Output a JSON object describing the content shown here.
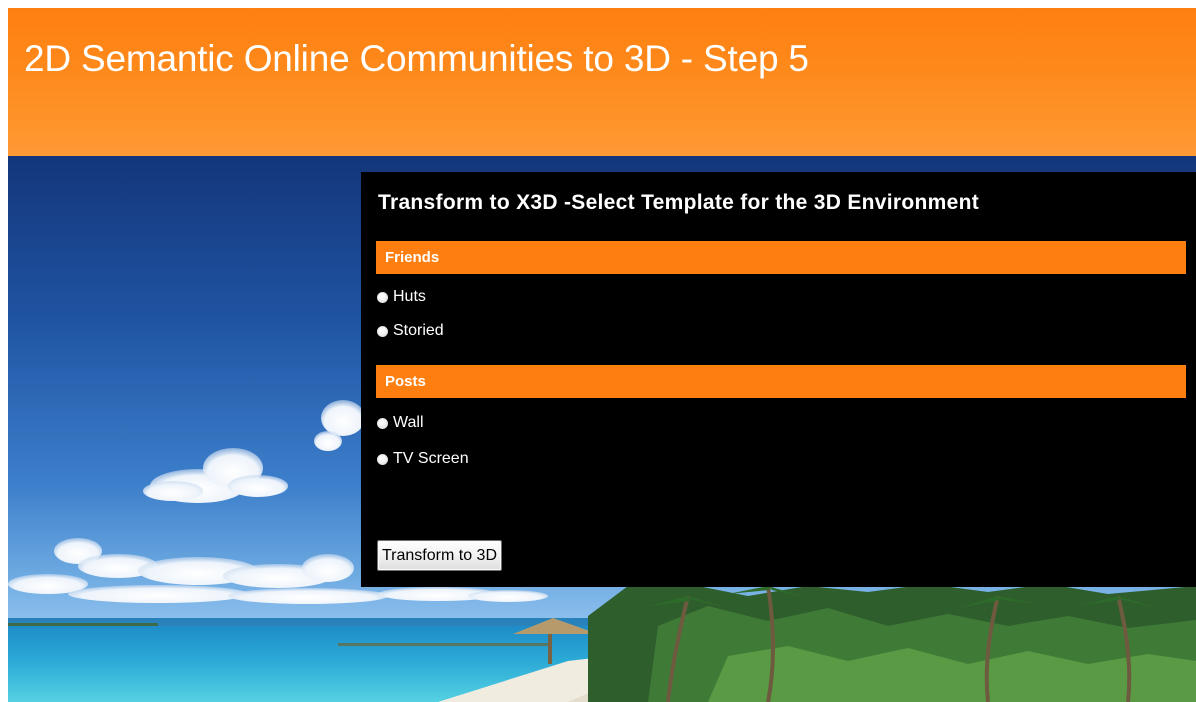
{
  "header": {
    "title": "2D Semantic Online Communities to 3D - Step 5"
  },
  "panel": {
    "title": "Transform to X3D -Select Template for the 3D Environment",
    "sections": [
      {
        "heading": "Friends",
        "options": [
          {
            "label": "Huts",
            "selected": false
          },
          {
            "label": "Storied",
            "selected": false
          }
        ]
      },
      {
        "heading": "Posts",
        "options": [
          {
            "label": "Wall",
            "selected": false
          },
          {
            "label": "TV Screen",
            "selected": false
          }
        ]
      }
    ],
    "submit_label": "Transform to 3D"
  },
  "colors": {
    "header_orange": "#fe7f10",
    "section_bar_orange": "#fe7f10",
    "panel_background": "#000000",
    "sky_blue": "#1e4f9c",
    "sea_turquoise": "#33b8d8"
  },
  "background_image": {
    "icon": "tropical-beach-scene"
  }
}
